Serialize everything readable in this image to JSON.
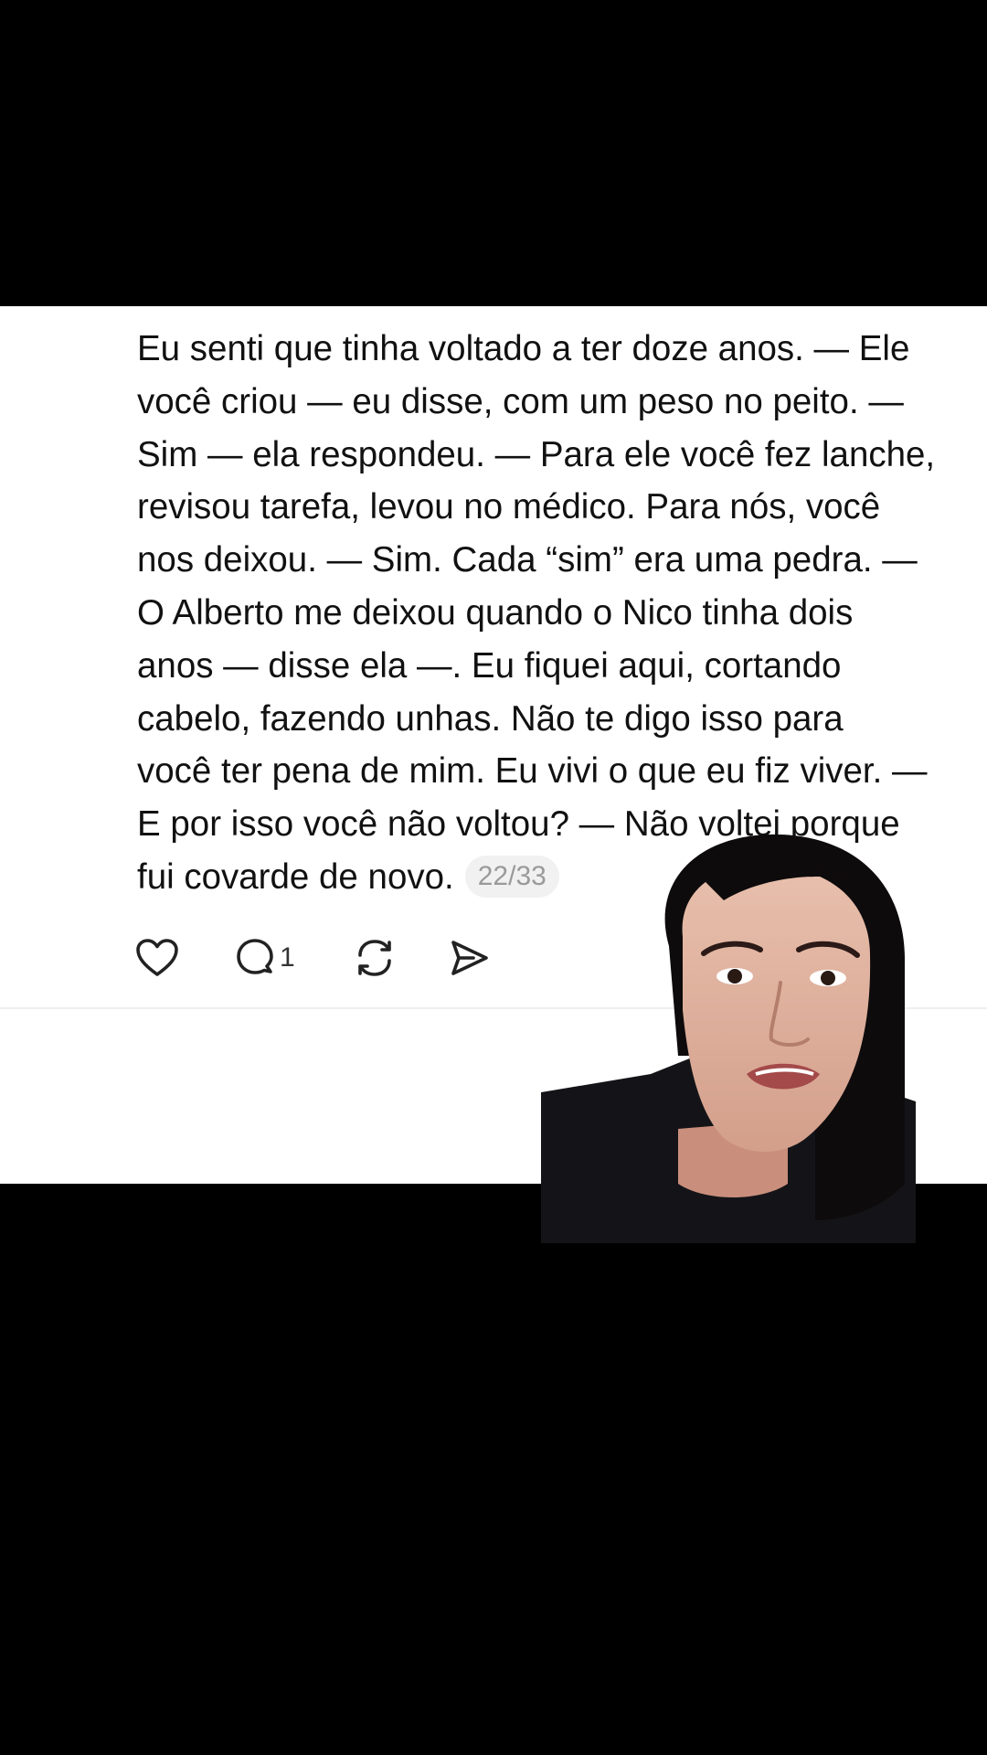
{
  "post": {
    "lines": [
      "Eu senti que tinha voltado a ter doze anos. — Ele",
      "você criou — eu disse, com um peso no peito. —",
      "Sim — ela respondeu. — Para ele você fez lanche,",
      "revisou tarefa, levou no médico. Para nós, você",
      "nos deixou. — Sim. Cada “sim” era uma pedra. —",
      "O Alberto me deixou quando o Nico tinha dois",
      "anos — disse ela —. Eu fiquei aqui, cortando",
      "cabelo, fazendo unhas. Não te digo isso para",
      "você ter pena de mim. Eu vivi o que eu fiz viver. —",
      "E por isso você não voltou? — Não voltei porque",
      "fui covarde de novo."
    ],
    "page_counter": "22/33"
  },
  "actions": {
    "like_icon": "heart-icon",
    "reply_icon": "speech-bubble-icon",
    "reply_count": "1",
    "repost_icon": "repost-arrows-icon",
    "share_icon": "paper-plane-icon"
  },
  "overlay": {
    "type": "picture-in-picture video of a woman speaking"
  },
  "colors": {
    "background": "#000000",
    "card": "#ffffff",
    "text": "#111111",
    "muted": "#9a9a9a"
  }
}
